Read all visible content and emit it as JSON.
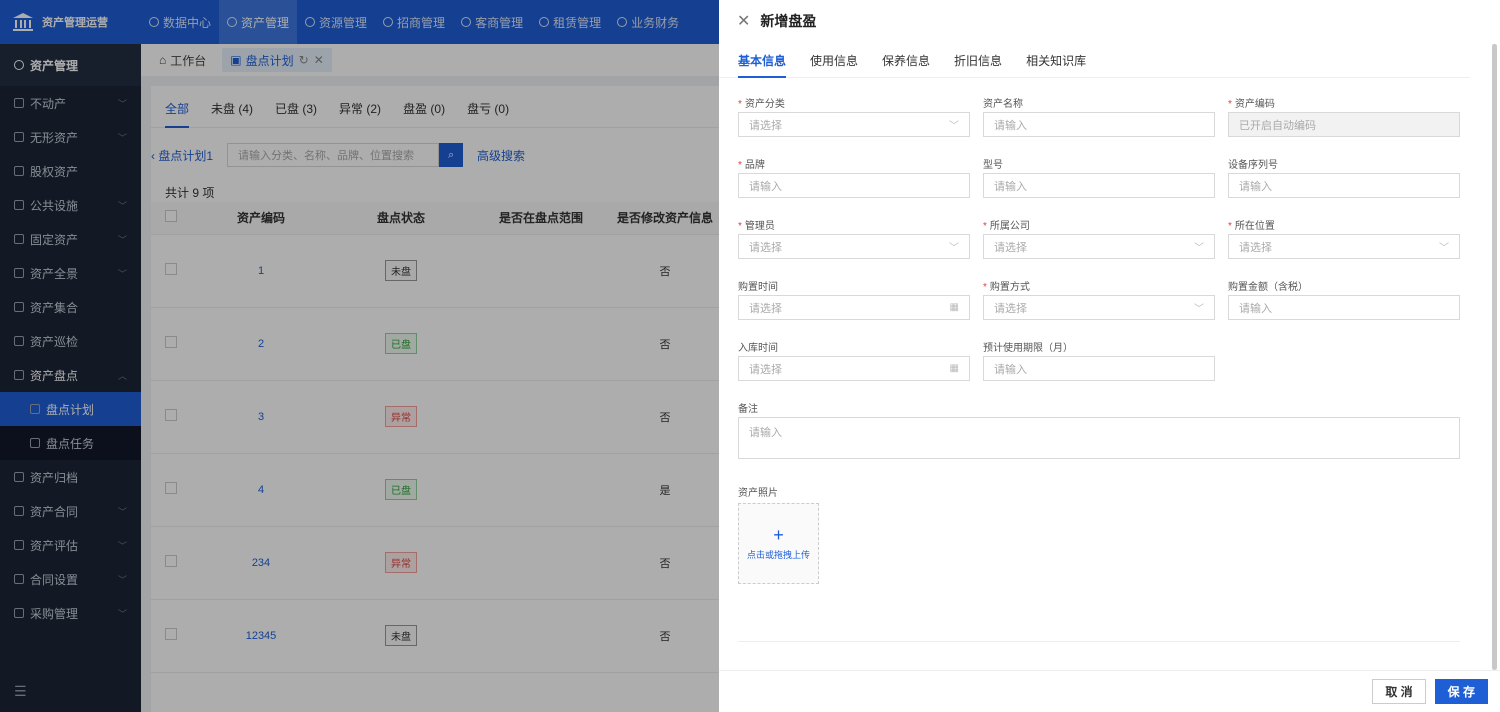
{
  "app": {
    "title": "资产管理运营",
    "nav": [
      "数据中心",
      "资产管理",
      "资源管理",
      "招商管理",
      "客商管理",
      "租赁管理",
      "业务财务"
    ],
    "nav_active": 1
  },
  "sidebar": {
    "header": "资产管理",
    "items": [
      {
        "label": "不动产",
        "chevron": "﹀"
      },
      {
        "label": "无形资产",
        "chevron": "﹀"
      },
      {
        "label": "股权资产",
        "chevron": ""
      },
      {
        "label": "公共设施",
        "chevron": "﹀"
      },
      {
        "label": "固定资产",
        "chevron": "﹀"
      },
      {
        "label": "资产全景",
        "chevron": "﹀"
      },
      {
        "label": "资产集合",
        "chevron": ""
      },
      {
        "label": "资产巡检",
        "chevron": ""
      },
      {
        "label": "资产盘点",
        "chevron": "︿"
      },
      {
        "label": "盘点计划",
        "sub": true,
        "active": true
      },
      {
        "label": "盘点任务",
        "sub": true
      },
      {
        "label": "资产归档",
        "chevron": ""
      },
      {
        "label": "资产合同",
        "chevron": "﹀"
      },
      {
        "label": "资产评估",
        "chevron": "﹀"
      },
      {
        "label": "合同设置",
        "chevron": "﹀"
      },
      {
        "label": "采购管理",
        "chevron": "﹀"
      }
    ],
    "collapse_icon": "☰"
  },
  "page_tabs": [
    {
      "label": "工作台"
    },
    {
      "label": "盘点计划",
      "active": true
    }
  ],
  "status_tabs": [
    "全部",
    "未盘 (4)",
    "已盘 (3)",
    "异常 (2)",
    "盘盈 (0)",
    "盘亏 (0)"
  ],
  "search": {
    "back": "盘点计划1",
    "placeholder": "请输入分类、名称、品牌、位置搜索",
    "advanced": "高级搜索"
  },
  "total": "共计 9 项",
  "table": {
    "headers": [
      "资产编码",
      "盘点状态",
      "是否在盘点范围",
      "是否修改资产信息"
    ],
    "rows": [
      {
        "code": "1",
        "status": "未盘",
        "tone": "gray",
        "modified": "否"
      },
      {
        "code": "2",
        "status": "已盘",
        "tone": "green",
        "modified": "否"
      },
      {
        "code": "3",
        "status": "异常",
        "tone": "red",
        "modified": "否"
      },
      {
        "code": "4",
        "status": "已盘",
        "tone": "green",
        "modified": "是"
      },
      {
        "code": "234",
        "status": "异常",
        "tone": "red",
        "modified": "否"
      },
      {
        "code": "12345",
        "status": "未盘",
        "tone": "gray",
        "modified": "否"
      }
    ]
  },
  "drawer": {
    "title": "新增盘盈",
    "tabs": [
      "基本信息",
      "使用信息",
      "保养信息",
      "折旧信息",
      "相关知识库"
    ],
    "fields": [
      [
        {
          "label": "资产分类",
          "req": true,
          "ph": "请选择",
          "kind": "select"
        },
        {
          "label": "资产名称",
          "req": false,
          "ph": "请输入",
          "kind": "input"
        },
        {
          "label": "资产编码",
          "req": true,
          "ph": "已开启自动编码",
          "kind": "disabled"
        }
      ],
      [
        {
          "label": "品牌",
          "req": true,
          "ph": "请输入",
          "kind": "input"
        },
        {
          "label": "型号",
          "req": false,
          "ph": "请输入",
          "kind": "input"
        },
        {
          "label": "设备序列号",
          "req": false,
          "ph": "请输入",
          "kind": "input"
        }
      ],
      [
        {
          "label": "管理员",
          "req": true,
          "ph": "请选择",
          "kind": "select"
        },
        {
          "label": "所属公司",
          "req": true,
          "ph": "请选择",
          "kind": "select"
        },
        {
          "label": "所在位置",
          "req": true,
          "ph": "请选择",
          "kind": "select"
        }
      ],
      [
        {
          "label": "购置时间",
          "req": false,
          "ph": "请选择",
          "kind": "date"
        },
        {
          "label": "购置方式",
          "req": true,
          "ph": "请选择",
          "kind": "select"
        },
        {
          "label": "购置金额（含税）",
          "req": false,
          "ph": "请输入",
          "kind": "input"
        }
      ],
      [
        {
          "label": "入库时间",
          "req": false,
          "ph": "请选择",
          "kind": "date"
        },
        {
          "label": "预计使用期限（月）",
          "req": false,
          "ph": "请输入",
          "kind": "input"
        }
      ]
    ],
    "remark_label": "备注",
    "remark_ph": "请输入",
    "photo_label": "资产照片",
    "upload_text": "点击或拖拽上传",
    "cancel": "取 消",
    "save": "保 存"
  }
}
